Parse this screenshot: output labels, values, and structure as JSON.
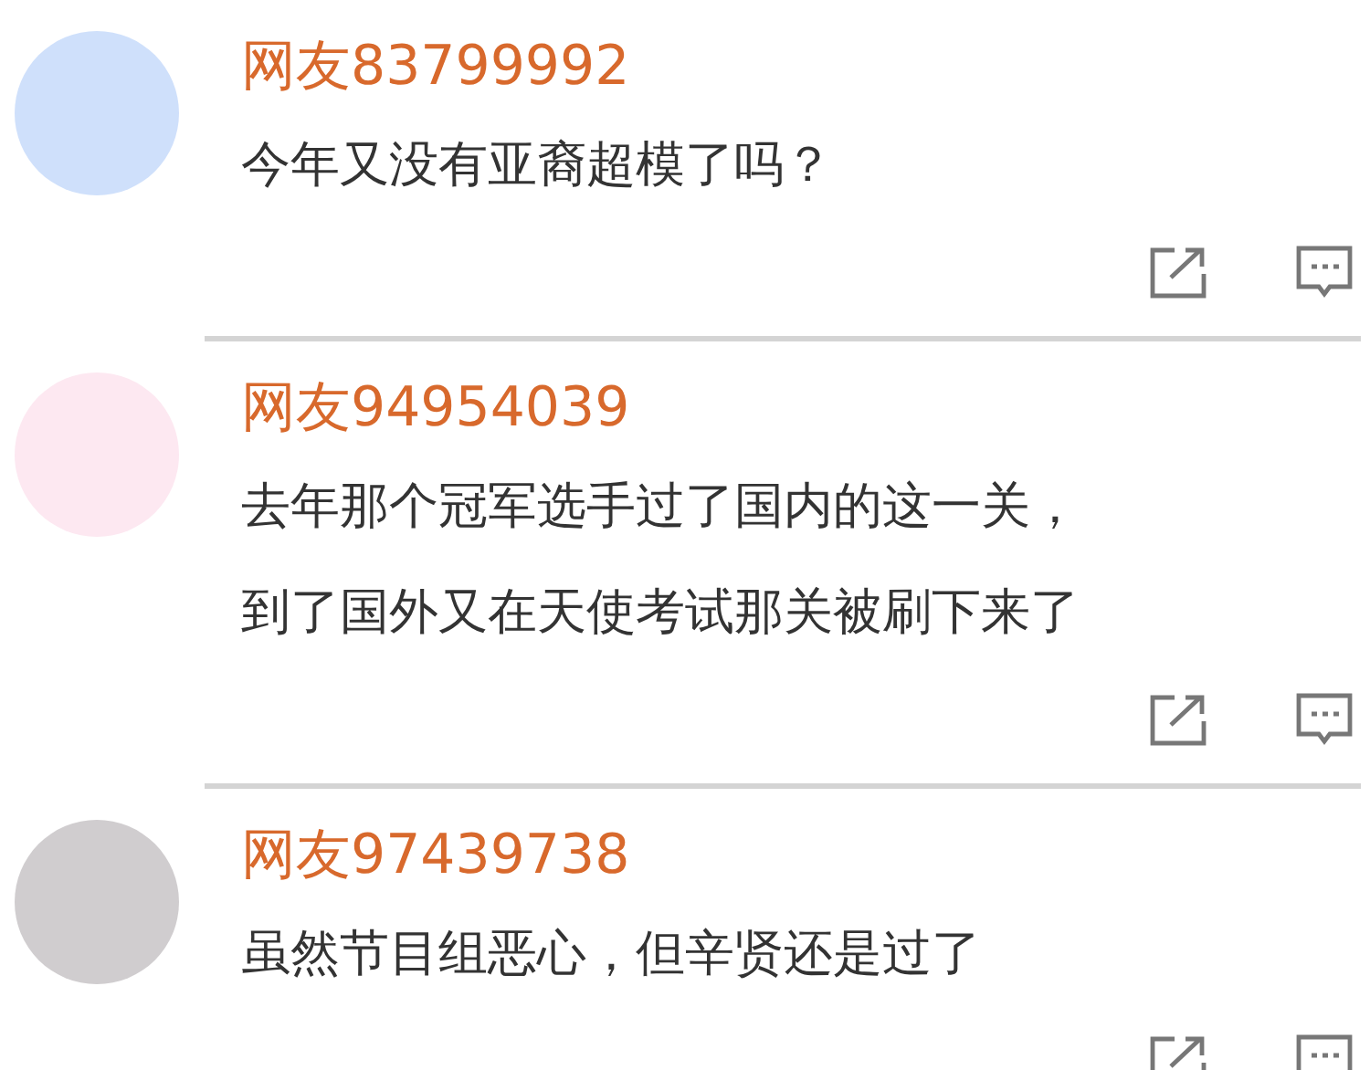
{
  "comments": [
    {
      "color": "#cfe0fb",
      "name": "网友83799992",
      "lines": [
        "今年又没有亚裔超模了吗？"
      ]
    },
    {
      "color": "#fde8f1",
      "name": "网友94954039",
      "lines": [
        "去年那个冠军选手过了国内的这一关，",
        "到了国外又在天使考试那关被刷下来了"
      ]
    },
    {
      "color": "#d0cdcf",
      "name": "网友97439738",
      "lines": [
        "虽然节目组恶心，但辛贤还是过了"
      ]
    }
  ]
}
